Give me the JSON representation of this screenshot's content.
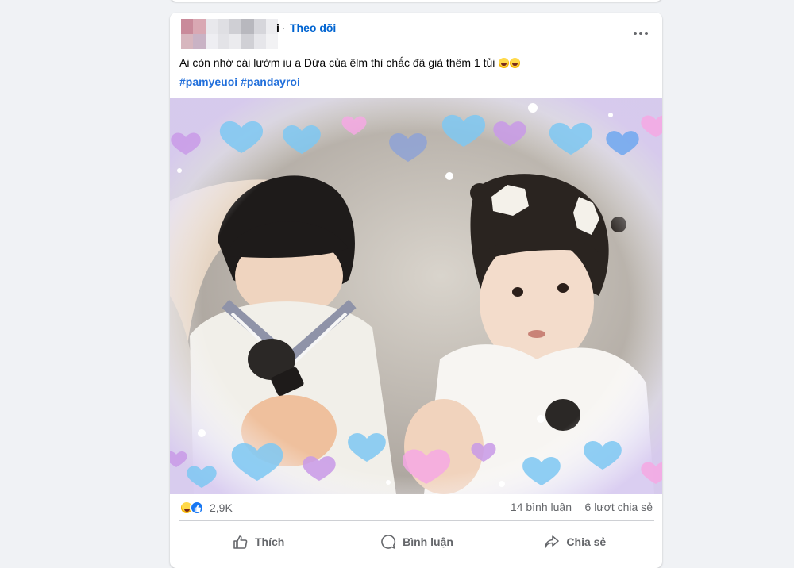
{
  "post": {
    "author_visible_suffix": "i",
    "separator": "·",
    "follow_label": "Theo dõi",
    "more_icon": "ellipsis-icon",
    "text": "Ai còn nhớ cái lườm iu a Dừa của êlm thì chắc đã già thêm 1 tủi",
    "text_emojis": [
      "laughing-tears-emoji",
      "laughing-tears-emoji"
    ],
    "hashtags": [
      "#pamyeuoi",
      "#pandayroi"
    ],
    "photo": {
      "description_icon": "photo",
      "accent_colors": [
        "#7ec8f3",
        "#c99ae8",
        "#f6a9e4",
        "#ffffff"
      ]
    },
    "reactions": {
      "icons": [
        "haha-reaction-icon",
        "like-reaction-icon"
      ],
      "count": "2,9K"
    },
    "comments_count": "14 bình luận",
    "shares_count": "6 lượt chia sẻ",
    "actions": {
      "like_label": "Thích",
      "comment_label": "Bình luận",
      "share_label": "Chia sẻ"
    }
  },
  "colors": {
    "page_bg": "#f0f2f5",
    "follow_blue": "#0064d1",
    "hashtag_blue": "#216fdb",
    "secondary_text": "#65676b"
  }
}
